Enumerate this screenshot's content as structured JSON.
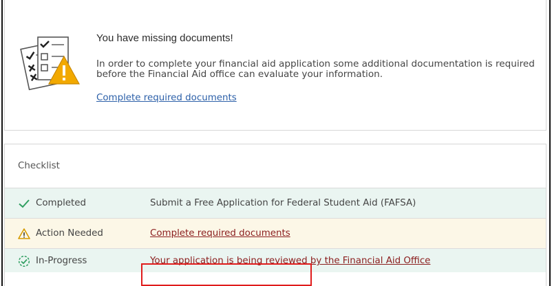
{
  "alert": {
    "title": "You have missing documents!",
    "body": "In order to complete your financial aid application some additional documentation is required before the Financial Aid office can evaluate your information.",
    "link_label": "Complete required documents",
    "icon": "document-warning-icon"
  },
  "checklist": {
    "header": "Checklist",
    "items": [
      {
        "status": "Completed",
        "icon": "check-icon",
        "task": "Submit a Free Application for Federal Student Aid (FAFSA)"
      },
      {
        "status": "Action Needed",
        "icon": "warning-icon",
        "task": "Complete required documents"
      },
      {
        "status": "In-Progress",
        "icon": "in-progress-check-icon",
        "task": "Your application is being reviewed by the Financial Aid Office"
      }
    ]
  },
  "colors": {
    "link_blue": "#2b5fa8",
    "link_red": "#8a1d1d",
    "check_green": "#2e9e60",
    "warning_amber": "#f2a900",
    "highlight_red": "#e01b1b"
  }
}
